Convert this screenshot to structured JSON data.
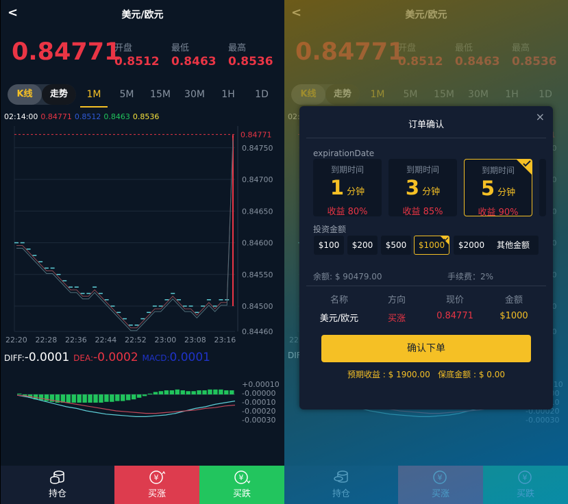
{
  "header": {
    "back": "<",
    "title": "美元/欧元"
  },
  "quote": {
    "price": "0.84771",
    "open_label": "开盘",
    "open": "0.8512",
    "low_label": "最低",
    "low": "0.8463",
    "high_label": "最高",
    "high": "0.8536"
  },
  "chart_tabs": {
    "kline": "K线",
    "trend": "走势",
    "timeframes": [
      "1M",
      "5M",
      "15M",
      "30M",
      "1H",
      "1D"
    ],
    "active": "1M"
  },
  "ohlc": {
    "time": "02:14:00",
    "c": "0.84771",
    "o": "0.8512",
    "l": "0.8463",
    "h": "0.8536"
  },
  "chart_data": {
    "type": "candlestick",
    "price_ticks": [
      "0.84750",
      "0.84700",
      "0.84650",
      "0.84600",
      "0.84550",
      "0.84500",
      "0.84460"
    ],
    "current_price_tag": "0.84771",
    "time_ticks": [
      "22:20",
      "22:28",
      "22:36",
      "22:44",
      "22:52",
      "23:00",
      "23:08",
      "23:16"
    ],
    "close": [
      0.846,
      0.846,
      0.8459,
      0.8458,
      0.8457,
      0.8456,
      0.8456,
      0.8455,
      0.8454,
      0.8453,
      0.8453,
      0.8452,
      0.8452,
      0.8453,
      0.8452,
      0.8451,
      0.845,
      0.8449,
      0.8448,
      0.8447,
      0.8447,
      0.8448,
      0.8449,
      0.845,
      0.845,
      0.8451,
      0.8452,
      0.8451,
      0.845,
      0.845,
      0.8449,
      0.845,
      0.8451,
      0.845,
      0.8451,
      0.8451,
      0.8477
    ],
    "macd": {
      "diff_label": "DIFF:",
      "diff": "-0.0001",
      "dea_label": "DEA:",
      "dea": "-0.0002",
      "macd_label": "MACD:",
      "macd_value": "0.0001",
      "ticks": [
        "+0.00010",
        "-0.00000",
        "-0.00010",
        "-0.00020",
        "-0.00030"
      ],
      "hist": [
        1e-05,
        -2e-05,
        -4e-05,
        -6e-05,
        -7e-05,
        -8e-05,
        -9e-05,
        -0.0001,
        -0.0001,
        -0.0001,
        -0.0001,
        -0.0001,
        -0.0001,
        -0.0001,
        -0.0001,
        -0.0001,
        -9e-05,
        -9e-05,
        -8e-05,
        -8e-05,
        -7e-05,
        -6e-05,
        -4e-05,
        -2e-05,
        1e-05,
        3e-05,
        4e-05,
        5e-05,
        5e-05,
        6e-05,
        5e-05,
        4e-05,
        4e-05,
        5e-05,
        5e-05,
        6e-05,
        6e-05,
        6e-05,
        5e-05,
        5e-05
      ],
      "diff_line": [
        -1e-05,
        -3e-05,
        -6e-05,
        -9e-05,
        -0.00012,
        -0.00015,
        -0.00017,
        -0.0002,
        -0.00022,
        -0.00024,
        -0.00025,
        -0.00026,
        -0.00027,
        -0.00027,
        -0.00026,
        -0.00025,
        -0.00023,
        -0.0002,
        -0.00017,
        -0.00015,
        -0.00012,
        -0.0001,
        -8e-05
      ],
      "dea_line": [
        -1e-05,
        -2e-05,
        -4e-05,
        -6e-05,
        -8e-05,
        -0.0001,
        -0.00012,
        -0.00014,
        -0.00016,
        -0.00018,
        -0.0002,
        -0.00021,
        -0.00022,
        -0.00023,
        -0.00023,
        -0.00022,
        -0.00021,
        -0.0002,
        -0.00019,
        -0.00017,
        -0.00016,
        -0.00014,
        -0.00013
      ]
    }
  },
  "bottom": {
    "positions": "持仓",
    "buy_up": "买涨",
    "buy_down": "买跌"
  },
  "modal": {
    "title": "订单确认",
    "close": "×",
    "expiration_label": "expirationDate",
    "durations": [
      {
        "label": "到期时间",
        "num": "1",
        "unit": "分钟",
        "profit": "收益 80%",
        "selected": false
      },
      {
        "label": "到期时间",
        "num": "3",
        "unit": "分钟",
        "profit": "收益 85%",
        "selected": false
      },
      {
        "label": "到期时间",
        "num": "5",
        "unit": "分钟",
        "profit": "收益 90%",
        "selected": true
      }
    ],
    "amount_label": "投资金额",
    "amounts": [
      "$100",
      "$200",
      "$500",
      "$1000",
      "$2000",
      "其他金额"
    ],
    "selected_amount": "$1000",
    "balance": "余额: $ 90479.00",
    "fee": "手续费：2%",
    "table_headers": [
      "名称",
      "方向",
      "现价",
      "金额"
    ],
    "table_values": [
      "美元/欧元",
      "买涨",
      "0.84771",
      "$1000"
    ],
    "confirm": "确认下单",
    "expected_profit": "预期收益 : $ 1900.00",
    "guarantee": "保底金额 : $ 0.00"
  },
  "colors": {
    "up": "#ea3545",
    "down": "#21c35c",
    "accent": "#f5c025",
    "bg": "#0b1624"
  }
}
